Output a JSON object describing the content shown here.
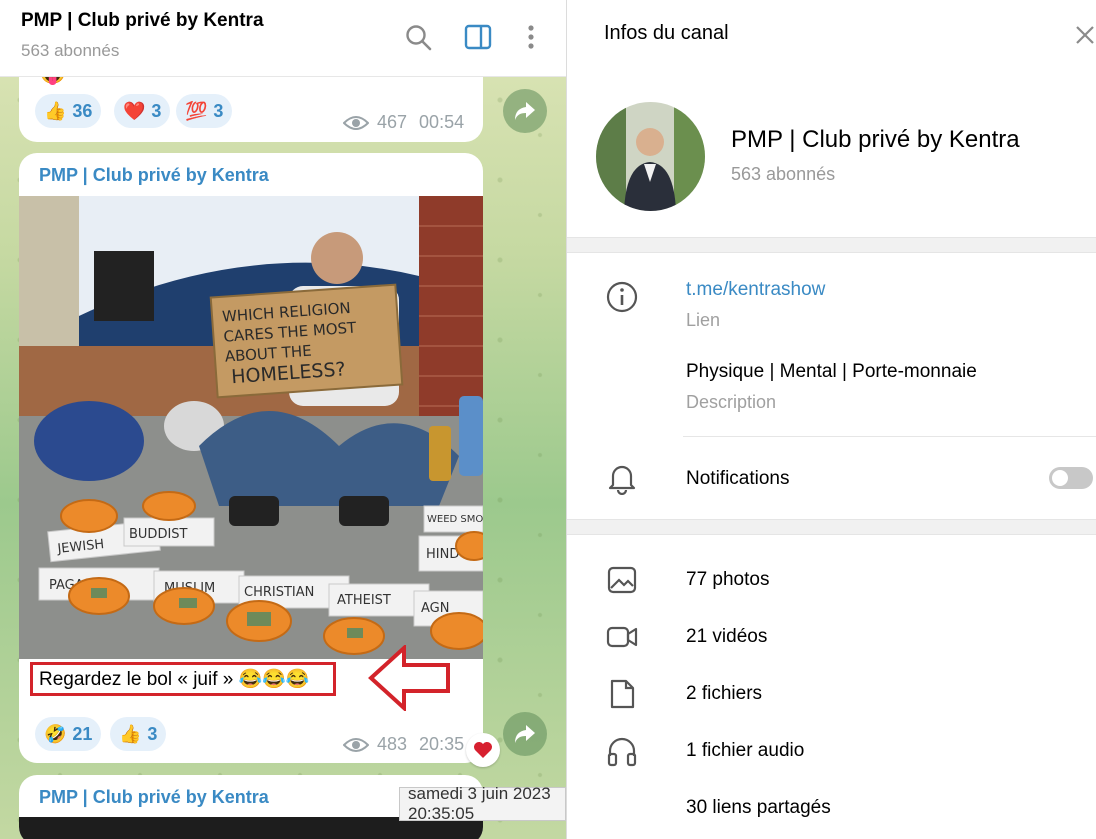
{
  "chat": {
    "title": "PMP | Club privé by Kentra",
    "subtitle": "563 abonnés",
    "messages": [
      {
        "reactions": [
          {
            "emoji": "👍",
            "count": "36"
          },
          {
            "emoji": "❤️",
            "count": "3"
          },
          {
            "emoji": "💯",
            "count": "3"
          }
        ],
        "views": "467",
        "time": "00:54"
      },
      {
        "sender": "PMP | Club privé by Kentra",
        "photo_sign": "WHICH RELIGION CARES THE MOST ABOUT THE HOMELESS?",
        "bowl_labels": [
          "JEWISH",
          "BUDDIST",
          "PAGAN",
          "MUSLIM",
          "CHRISTIAN",
          "ATHEIST",
          "AGN",
          "HINDU",
          "WEED SMOKER"
        ],
        "caption": "Regardez le bol « juif » 😂😂😂",
        "reactions": [
          {
            "emoji": "🤣",
            "count": "21"
          },
          {
            "emoji": "👍",
            "count": "3"
          }
        ],
        "views": "483",
        "time": "20:35",
        "tooltip": "samedi 3 juin 2023 20:35:05"
      },
      {
        "sender": "PMP | Club privé by Kentra"
      }
    ]
  },
  "panel": {
    "title": "Infos du canal",
    "channel_name": "PMP | Club privé by Kentra",
    "channel_subs": "563 abonnés",
    "link": "t.me/kentrashow",
    "link_label": "Lien",
    "description": "Physique | Mental | Porte-monnaie",
    "description_label": "Description",
    "notifications_label": "Notifications",
    "notifications_enabled": false,
    "media": [
      {
        "icon": "photo-icon",
        "label": "77 photos"
      },
      {
        "icon": "video-icon",
        "label": "21 vidéos"
      },
      {
        "icon": "file-icon",
        "label": "2 fichiers"
      },
      {
        "icon": "headphones-icon",
        "label": "1 fichier audio"
      },
      {
        "icon": "link-icon",
        "label": "30 liens partagés"
      }
    ]
  },
  "colors": {
    "accent": "#3a8ac4",
    "highlight_box": "#d3232a",
    "reaction_bg": "#e5f0fa"
  }
}
